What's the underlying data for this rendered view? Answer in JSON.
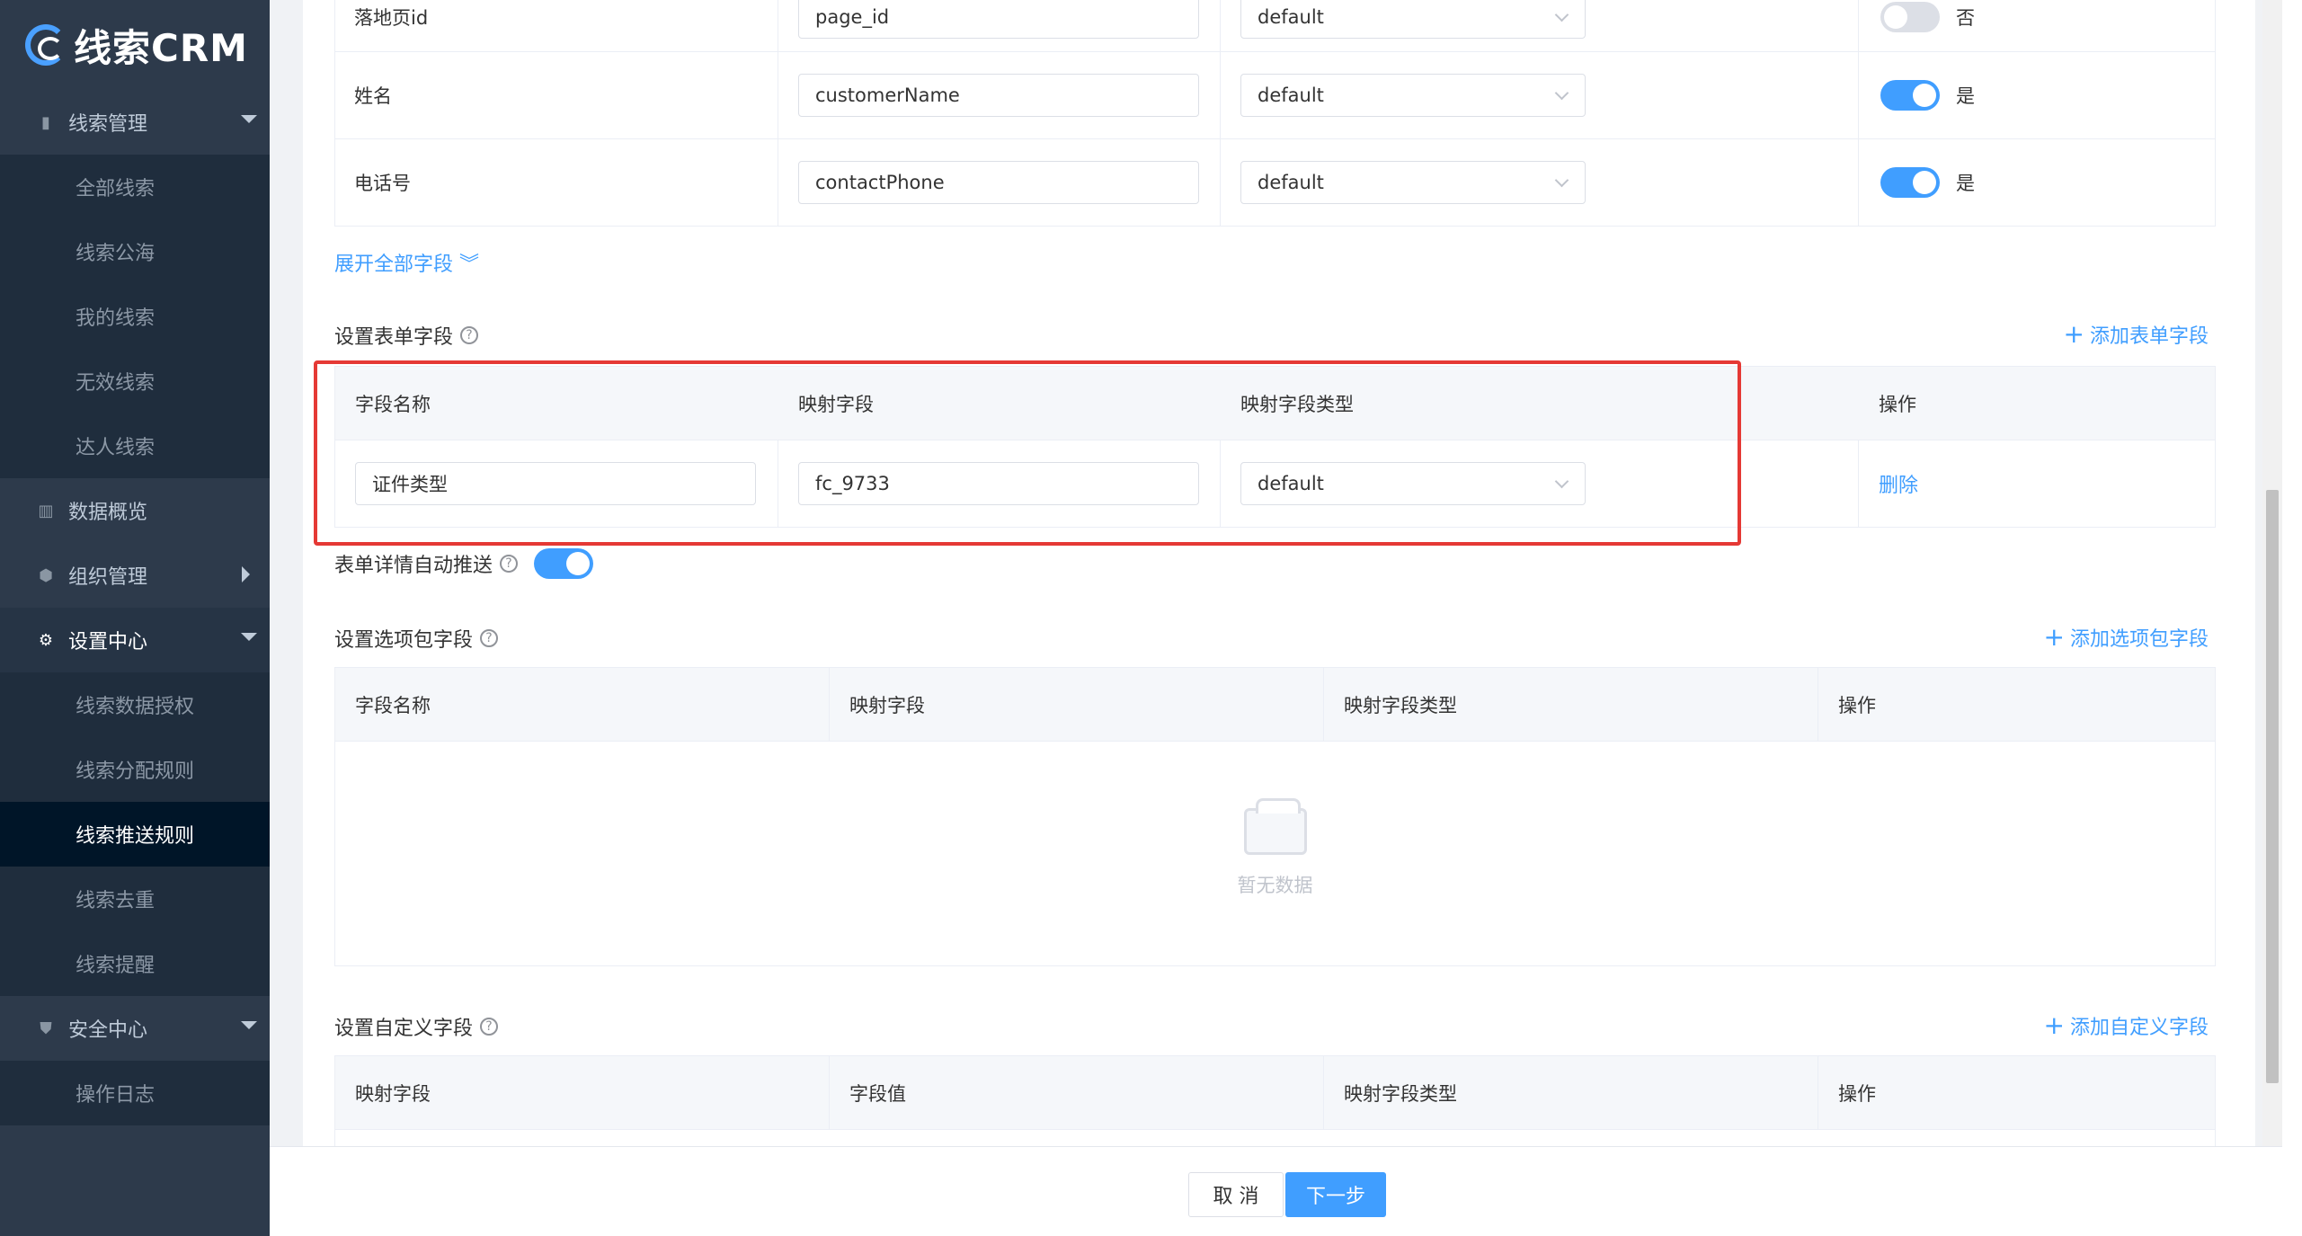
{
  "logo": "线索CRM",
  "sidebar": {
    "groups": [
      {
        "label": "线索管理",
        "icon": "book-icon"
      },
      {
        "label": "数据概览",
        "icon": "chart-icon"
      },
      {
        "label": "组织管理",
        "icon": "cube-icon"
      },
      {
        "label": "设置中心",
        "icon": "gear-icon"
      },
      {
        "label": "安全中心",
        "icon": "shield-icon"
      }
    ],
    "lead_items": [
      "全部线索",
      "线索公海",
      "我的线索",
      "无效线索",
      "达人线索"
    ],
    "settings_items": [
      "线索数据授权",
      "线索分配规则",
      "线索推送规则",
      "线索去重",
      "线索提醒"
    ],
    "security_items": [
      "操作日志"
    ]
  },
  "top_rows": [
    {
      "name": "落地页id",
      "field": "page_id",
      "type": "default",
      "enabled": false,
      "enabled_label": "否"
    },
    {
      "name": "姓名",
      "field": "customerName",
      "type": "default",
      "enabled": true,
      "enabled_label": "是"
    },
    {
      "name": "电话号",
      "field": "contactPhone",
      "type": "default",
      "enabled": true,
      "enabled_label": "是"
    }
  ],
  "expand_link": "展开全部字段",
  "form_section": {
    "title": "设置表单字段",
    "add_label": "添加表单字段",
    "headers": [
      "字段名称",
      "映射字段",
      "映射字段类型",
      "操作"
    ],
    "row": {
      "name": "证件类型",
      "field": "fc_9733",
      "type": "default",
      "action": "删除"
    }
  },
  "auto_push_label": "表单详情自动推送",
  "option_section": {
    "title": "设置选项包字段",
    "add_label": "添加选项包字段",
    "headers": [
      "字段名称",
      "映射字段",
      "映射字段类型",
      "操作"
    ],
    "empty": "暂无数据"
  },
  "custom_section": {
    "title": "设置自定义字段",
    "add_label": "添加自定义字段",
    "headers": [
      "映射字段",
      "字段值",
      "映射字段类型",
      "操作"
    ]
  },
  "footer": {
    "cancel": "取 消",
    "next": "下一步"
  }
}
